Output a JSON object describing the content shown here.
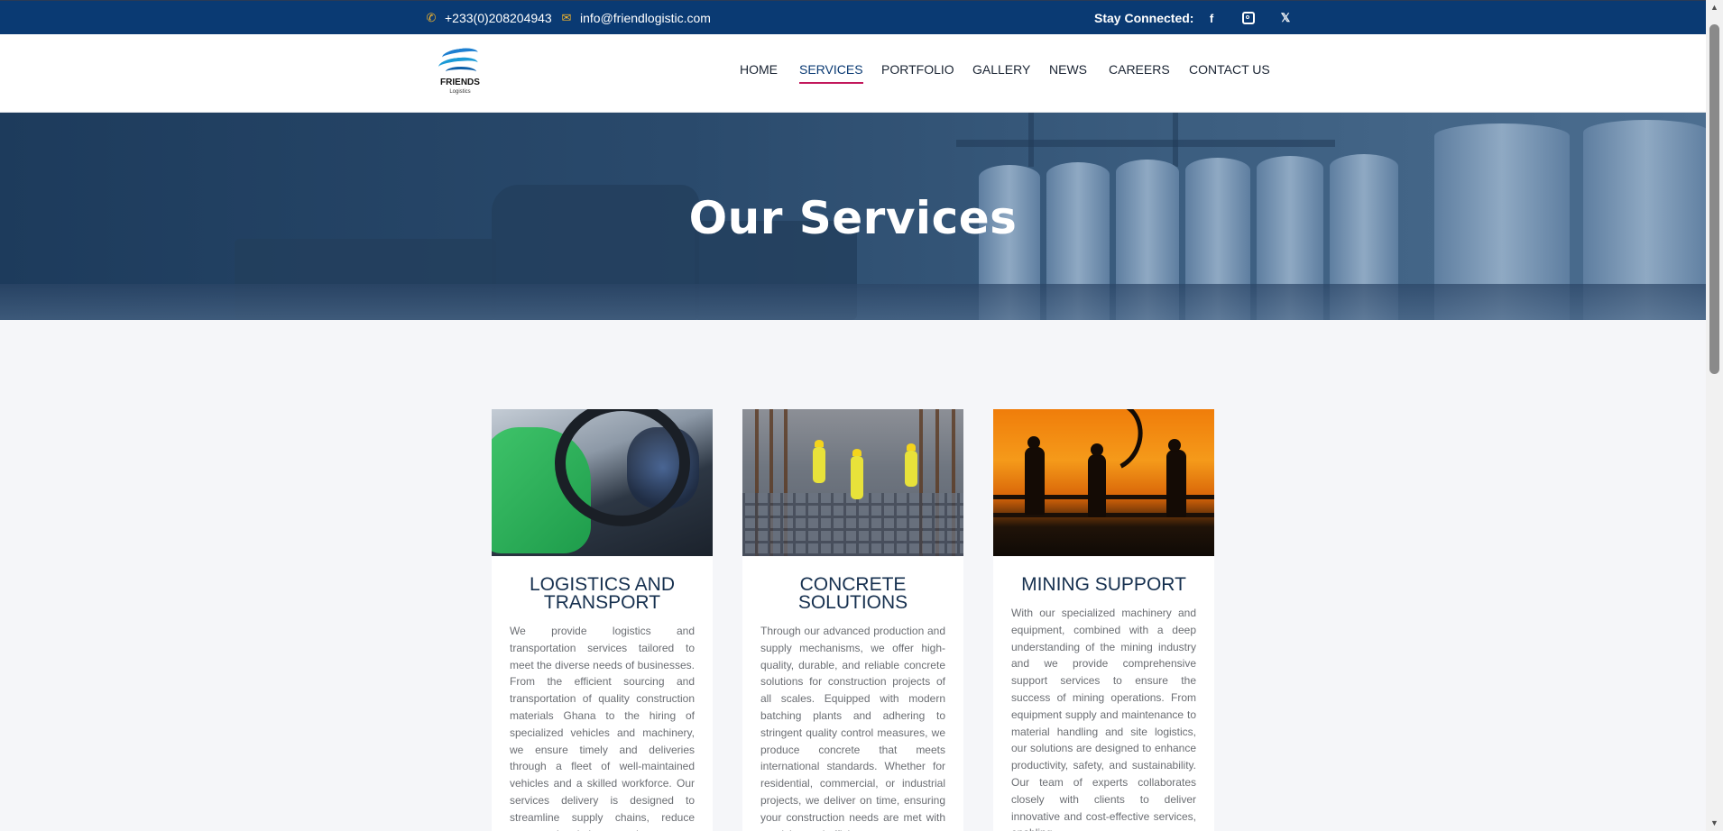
{
  "topbar": {
    "phone": "+233(0)208204943",
    "email": "info@friendlogistic.com",
    "stay_connected": "Stay Connected:",
    "icons": [
      "phone-icon",
      "email-icon",
      "facebook-icon",
      "instagram-icon",
      "x-icon"
    ],
    "accent": "#f3b52d",
    "background": "#0a3a73"
  },
  "logo": {
    "name": "FRIENDS",
    "sub": "Logistics"
  },
  "nav": {
    "items": [
      "HOME",
      "SERVICES",
      "PORTFOLIO",
      "GALLERY",
      "NEWS",
      "CAREERS",
      "CONTACT US"
    ],
    "active": "SERVICES",
    "underline_color": "#c2185b"
  },
  "hero": {
    "title": "Our Services"
  },
  "services": [
    {
      "title": "LOGISTICS AND TRANSPORT",
      "text": "We provide logistics and transportation services tailored to meet the diverse needs of businesses. From the efficient sourcing and transportation of quality construction materials Ghana to the hiring of specialized vehicles and machinery, we ensure timely and deliveries through a fleet of well-maintained vehicles and a skilled workforce. Our services delivery is designed to streamline supply chains, reduce costs, and optimize operations"
    },
    {
      "title": "CONCRETE SOLUTIONS",
      "text": "Through our advanced production and supply mechanisms, we offer high-quality, durable, and reliable concrete solutions for construction projects of all scales. Equipped with modern batching plants and adhering to stringent quality control measures, we produce concrete that meets international standards. Whether for residential, commercial, or industrial projects, we deliver on time, ensuring your construction needs are met with precision and efficiency."
    },
    {
      "title": "MINING SUPPORT",
      "text": "With our specialized machinery and equipment, combined with a deep understanding of the mining industry and we provide comprehensive support services to ensure the success of mining operations. From equipment supply and maintenance to material handling and site logistics, our solutions are designed to enhance productivity, safety, and sustainability. Our team of experts collaborates closely with clients to deliver innovative and cost-effective services, enabling"
    }
  ]
}
